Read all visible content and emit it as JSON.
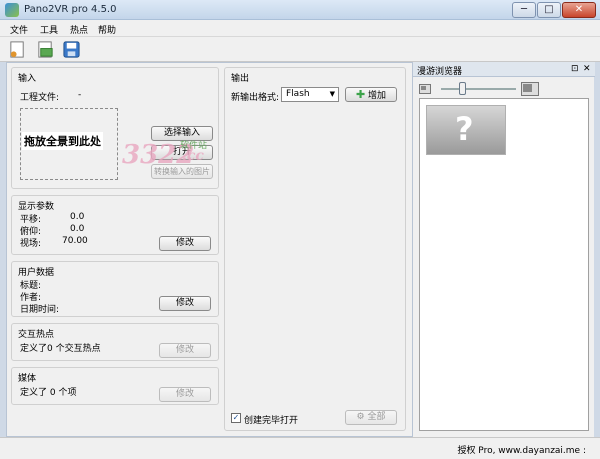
{
  "window": {
    "title": "Pano2VR pro 4.5.0",
    "minimize": "─",
    "maximize": "□",
    "close": "✕"
  },
  "menu": {
    "items": [
      "文件",
      "工具",
      "热点",
      "帮助"
    ]
  },
  "toolbar": {
    "new_icon": "new-project-icon",
    "open_icon": "open-project-icon",
    "save_icon": "save-icon"
  },
  "input_panel": {
    "title": "输入",
    "project_file_label": "工程文件:",
    "project_file_value": "-",
    "drop_text": "拖放全景到此处",
    "select_input_button": "选择输入",
    "open_button": "打开",
    "convert_button": "转换输入的图片"
  },
  "display_params": {
    "title": "显示参数",
    "pan_label": "平移:",
    "pan_value": "0.0",
    "tilt_label": "俯仰:",
    "tilt_value": "0.0",
    "fov_label": "视场:",
    "fov_value": "70.00",
    "modify_button": "修改"
  },
  "user_data": {
    "title": "用户数据",
    "title_label": "标题:",
    "author_label": "作者:",
    "datetime_label": "日期时间:",
    "modify_button": "修改"
  },
  "hotspots": {
    "title": "交互热点",
    "summary": "定义了0 个交互热点",
    "modify_button": "修改"
  },
  "media": {
    "title": "媒体",
    "summary": "定义了 0 个项",
    "modify_button": "修改"
  },
  "output_panel": {
    "title": "输出",
    "new_format_label": "新输出格式:",
    "format_selected": "Flash",
    "add_button": "增加",
    "open_after_label": "创建完毕打开",
    "open_after_checked": true,
    "all_button": "全部"
  },
  "tour_browser": {
    "title": "漫游浏览器",
    "pin": "⊡",
    "close": "✕",
    "thumb_symbol": "?"
  },
  "statusbar": {
    "text": "授权 Pro, www.dayanzai.me :"
  },
  "watermark": {
    "number": "3322",
    "suffix": ".cc",
    "tagline": "软件站"
  },
  "colors": {
    "title_bar": "#c9d9ec",
    "panel_bg": "#f0f0f0",
    "accent_add": "#3ca34a"
  }
}
